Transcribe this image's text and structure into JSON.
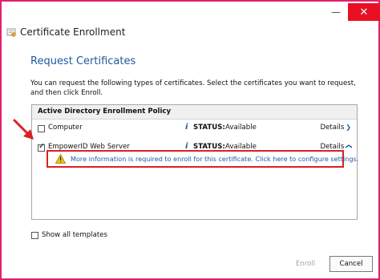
{
  "window": {
    "title": "Certificate Enrollment",
    "controls": {
      "minimize": "—",
      "close": "✕"
    }
  },
  "page": {
    "section_title": "Request Certificates",
    "intro": "You can request the following types of certificates. Select the certificates you want to request, and then click Enroll."
  },
  "policy": {
    "header": "Active Directory Enrollment Policy",
    "rows": [
      {
        "name": "Computer",
        "checked": false,
        "status_label": "STATUS:",
        "status_value": "Available",
        "details": "Details"
      },
      {
        "name": "EmpowerID Web Server",
        "checked": true,
        "status_label": "STATUS:",
        "status_value": "Available",
        "details": "Details"
      }
    ],
    "warning": "More information is required to enroll for this certificate. Click here to configure settings."
  },
  "footer": {
    "show_all": "Show all templates",
    "enroll": "Enroll",
    "cancel": "Cancel"
  },
  "colors": {
    "frame": "#e0216e",
    "accent_blue": "#1e5a9e",
    "warning_border": "#d92026",
    "arrow": "#d92026",
    "close_button": "#e81123"
  },
  "icons": [
    "certificate-icon",
    "info-icon",
    "warning-icon",
    "chevron-down-icon",
    "arrow-icon"
  ]
}
